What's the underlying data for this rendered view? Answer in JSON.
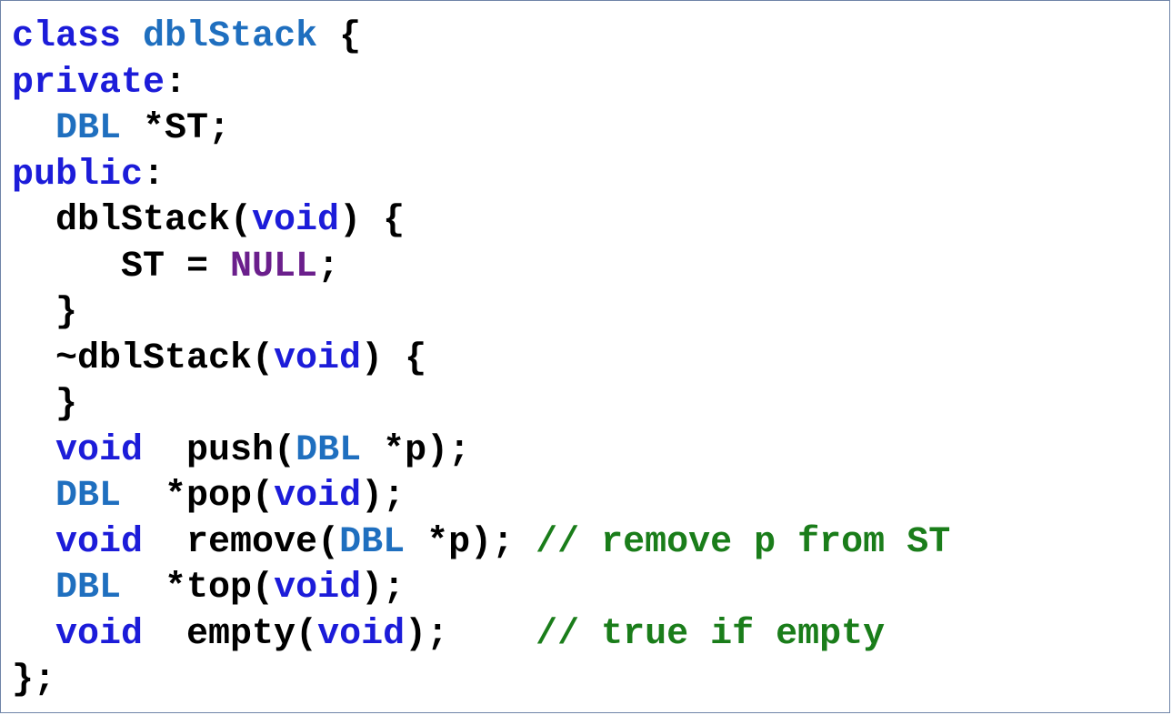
{
  "code_lines": [
    [
      {
        "t": "class",
        "c": "kw"
      },
      {
        "t": " "
      },
      {
        "t": "dblStack",
        "c": "ty"
      },
      {
        "t": " {"
      }
    ],
    [
      {
        "t": "private",
        "c": "kw"
      },
      {
        "t": ":"
      }
    ],
    [
      {
        "t": "  "
      },
      {
        "t": "DBL",
        "c": "ty"
      },
      {
        "t": " *ST;"
      }
    ],
    [
      {
        "t": "public",
        "c": "kw"
      },
      {
        "t": ":"
      }
    ],
    [
      {
        "t": "  dblStack("
      },
      {
        "t": "void",
        "c": "kw"
      },
      {
        "t": ") {"
      }
    ],
    [
      {
        "t": "     ST = "
      },
      {
        "t": "NULL",
        "c": "nu"
      },
      {
        "t": ";"
      }
    ],
    [
      {
        "t": "  }"
      }
    ],
    [
      {
        "t": "  ~dblStack("
      },
      {
        "t": "void",
        "c": "kw"
      },
      {
        "t": ") {"
      }
    ],
    [
      {
        "t": "  }"
      }
    ],
    [
      {
        "t": "  "
      },
      {
        "t": "void",
        "c": "kw"
      },
      {
        "t": "  push("
      },
      {
        "t": "DBL",
        "c": "ty"
      },
      {
        "t": " *p);"
      }
    ],
    [
      {
        "t": "  "
      },
      {
        "t": "DBL",
        "c": "ty"
      },
      {
        "t": "  *pop("
      },
      {
        "t": "void",
        "c": "kw"
      },
      {
        "t": ");"
      }
    ],
    [
      {
        "t": "  "
      },
      {
        "t": "void",
        "c": "kw"
      },
      {
        "t": "  remove("
      },
      {
        "t": "DBL",
        "c": "ty"
      },
      {
        "t": " *p); "
      },
      {
        "t": "// remove p from ST",
        "c": "cm"
      }
    ],
    [
      {
        "t": "  "
      },
      {
        "t": "DBL",
        "c": "ty"
      },
      {
        "t": "  *top("
      },
      {
        "t": "void",
        "c": "kw"
      },
      {
        "t": ");"
      }
    ],
    [
      {
        "t": "  "
      },
      {
        "t": "void",
        "c": "kw"
      },
      {
        "t": "  empty("
      },
      {
        "t": "void",
        "c": "kw"
      },
      {
        "t": ");    "
      },
      {
        "t": "// true if empty",
        "c": "cm"
      }
    ],
    [
      {
        "t": "};"
      }
    ]
  ],
  "colors": {
    "keyword": "#1c1cd9",
    "type": "#1f6fbf",
    "constant": "#6b1f8c",
    "comment": "#1a7d1a",
    "border": "#6f84a8"
  }
}
